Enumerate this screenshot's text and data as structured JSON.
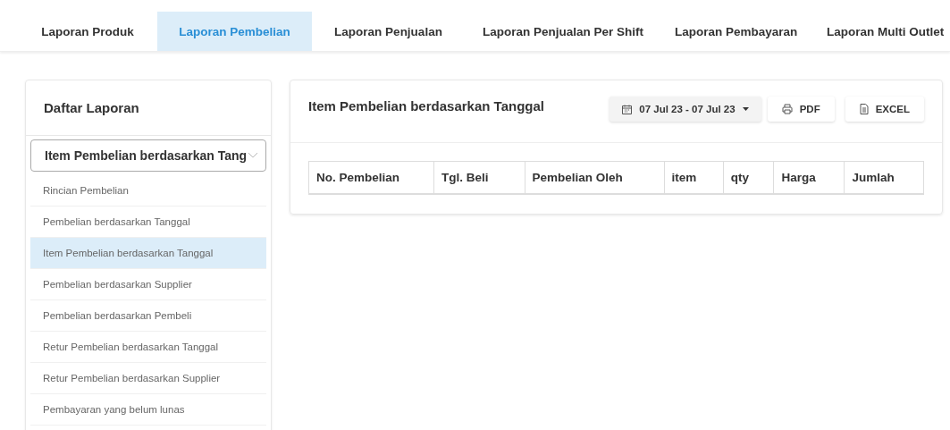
{
  "tabs": [
    {
      "label": "Laporan Produk",
      "selected": false
    },
    {
      "label": "Laporan Pembelian",
      "selected": true
    },
    {
      "label": "Laporan Penjualan",
      "selected": false
    },
    {
      "label": "Laporan Penjualan Per Shift",
      "selected": false
    },
    {
      "label": "Laporan Pembayaran",
      "selected": false
    },
    {
      "label": "Laporan Multi Outlet",
      "selected": false
    }
  ],
  "sidebar": {
    "title": "Daftar Laporan",
    "select_value": "Item Pembelian berdasarkan Tang",
    "items": [
      {
        "label": "Rincian Pembelian",
        "selected": false
      },
      {
        "label": "Pembelian berdasarkan Tanggal",
        "selected": false
      },
      {
        "label": "Item Pembelian berdasarkan Tanggal",
        "selected": true
      },
      {
        "label": "Pembelian berdasarkan Supplier",
        "selected": false
      },
      {
        "label": "Pembelian berdasarkan Pembeli",
        "selected": false
      },
      {
        "label": "Retur Pembelian berdasarkan Tanggal",
        "selected": false
      },
      {
        "label": "Retur Pembelian berdasarkan Supplier",
        "selected": false
      },
      {
        "label": "Pembayaran yang belum lunas",
        "selected": false
      }
    ]
  },
  "panel": {
    "title": "Item Pembelian berdasarkan Tanggal",
    "date_range": "07 Jul 23 - 07 Jul 23",
    "buttons": [
      {
        "kind": "print",
        "label": "PDF"
      },
      {
        "kind": "file",
        "label": "EXCEL"
      }
    ],
    "table": {
      "columns": [
        "No. Pembelian",
        "Tgl. Beli",
        "Pembelian Oleh",
        "item",
        "qty",
        "Harga",
        "Jumlah"
      ]
    }
  }
}
